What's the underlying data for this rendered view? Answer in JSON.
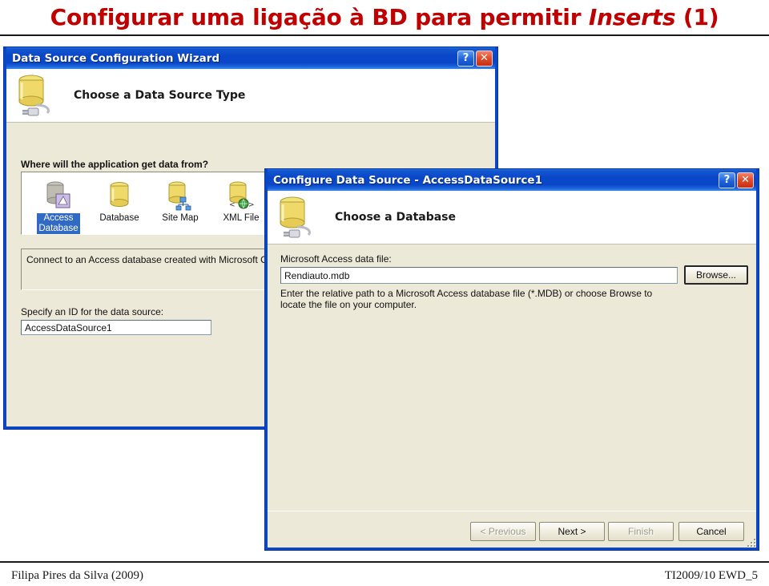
{
  "slide": {
    "title_main": "Configurar uma ligação à BD para permitir ",
    "title_italic": "Inserts",
    "title_suffix": " (1)",
    "title_color": "#c00000",
    "footer_left": "Filipa Pires da Silva (2009)",
    "footer_right": "TI2009/10 EWD_5"
  },
  "wizard": {
    "titlebar": {
      "title": "Data Source Configuration Wizard",
      "help_label": "?",
      "close_label": "✕"
    },
    "header": {
      "title": "Choose a Data Source Type",
      "icon": "database-plug-icon"
    },
    "prompt_label": "Where will the application get data from?",
    "tiles": [
      {
        "label": "Access\nDatabase",
        "icon": "access-database-icon",
        "selected": true
      },
      {
        "label": "Database",
        "icon": "database-icon",
        "selected": false
      },
      {
        "label": "Site Map",
        "icon": "site-map-icon",
        "selected": false
      },
      {
        "label": "XML File",
        "icon": "xml-file-icon",
        "selected": false
      }
    ],
    "description": "Connect to an Access database created with Microsoft Offi",
    "id_label": "Specify an ID for the data source:",
    "id_value": "AccessDataSource1"
  },
  "configure": {
    "titlebar": {
      "title": "Configure Data Source - AccessDataSource1",
      "help_label": "?",
      "close_label": "✕"
    },
    "header": {
      "title": "Choose a Database",
      "icon": "database-plug-icon"
    },
    "file_label": "Microsoft Access data file:",
    "file_value": "Rendiauto.mdb",
    "browse_label": "Browse...",
    "hint_line1": "Enter the relative path to a Microsoft Access database file (*.MDB) or choose Browse to",
    "hint_line2": "locate the file on your computer.",
    "buttons": [
      {
        "label": "< Previous",
        "disabled": true,
        "default": false
      },
      {
        "label": "Next >",
        "disabled": false,
        "default": true
      },
      {
        "label": "Finish",
        "disabled": true,
        "default": false
      },
      {
        "label": "Cancel",
        "disabled": false,
        "default": false
      }
    ]
  }
}
